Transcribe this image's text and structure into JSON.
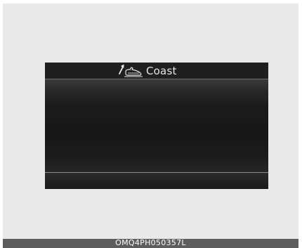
{
  "display": {
    "title_icon": "coast-icon",
    "indicator_icon": "arrow-icon",
    "mode_label": "Coast"
  },
  "footer": {
    "caption": "OMQ4PH050357L"
  },
  "colors": {
    "screen_background": "#161616",
    "panel_background": "#e9e9e9",
    "caption_bar": "#5d5d5d",
    "label_text": "#e6e6e6"
  }
}
